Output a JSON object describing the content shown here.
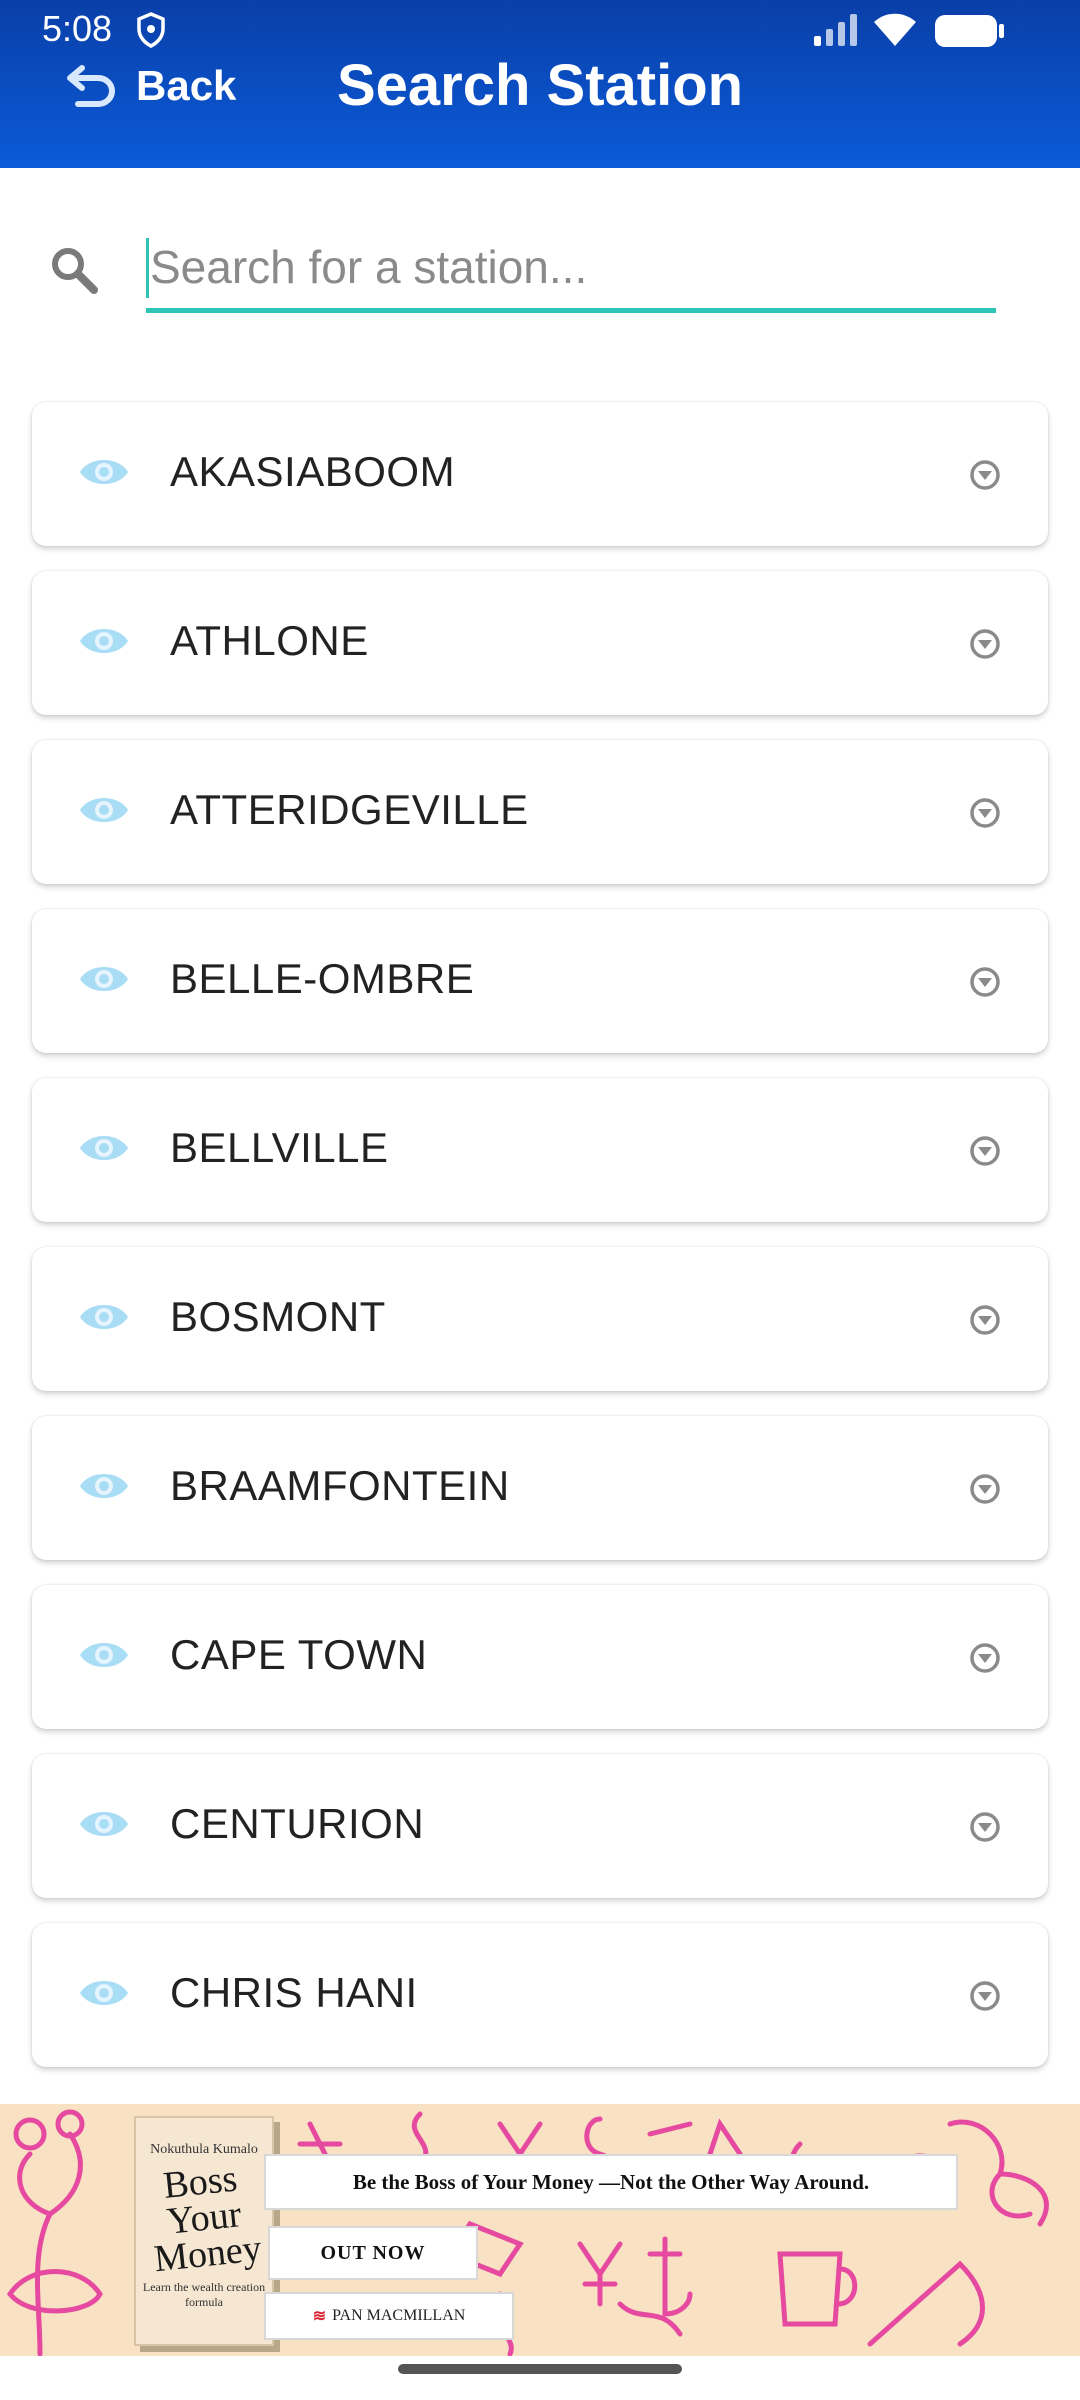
{
  "status_bar": {
    "time": "5:08"
  },
  "header": {
    "back_label": "Back",
    "title": "Search Station"
  },
  "search": {
    "placeholder": "Search for a station...",
    "value": ""
  },
  "stations": [
    {
      "name": "AKASIABOOM"
    },
    {
      "name": "ATHLONE"
    },
    {
      "name": "ATTERIDGEVILLE"
    },
    {
      "name": "BELLE-OMBRE"
    },
    {
      "name": "BELLVILLE"
    },
    {
      "name": "BOSMONT"
    },
    {
      "name": "BRAAMFONTEIN"
    },
    {
      "name": "CAPE TOWN"
    },
    {
      "name": "CENTURION"
    },
    {
      "name": "CHRIS HANI"
    }
  ],
  "ad": {
    "book_author": "Nokuthula Kumalo",
    "book_title_1": "Boss",
    "book_title_2": "Your",
    "book_title_3": "Money",
    "book_subtitle": "Learn the wealth creation formula",
    "tagline": "Be the Boss of Your Money —Not the Other Way Around.",
    "cta": "OUT NOW",
    "publisher": "PAN MACMILLAN"
  },
  "colors": {
    "header_top": "#0a3fa8",
    "header_bottom": "#0b5bd8",
    "search_underline": "#2ec4b6",
    "eye_icon": "#a9dcf5",
    "chevron_icon": "#8a8a8a",
    "ad_background": "#f9e1c4",
    "ad_doodle": "#e64aa0"
  },
  "icons": {
    "back": "back-arrow-icon",
    "search": "search-icon",
    "station": "eye-icon",
    "expand": "chevron-down-circle-icon"
  }
}
